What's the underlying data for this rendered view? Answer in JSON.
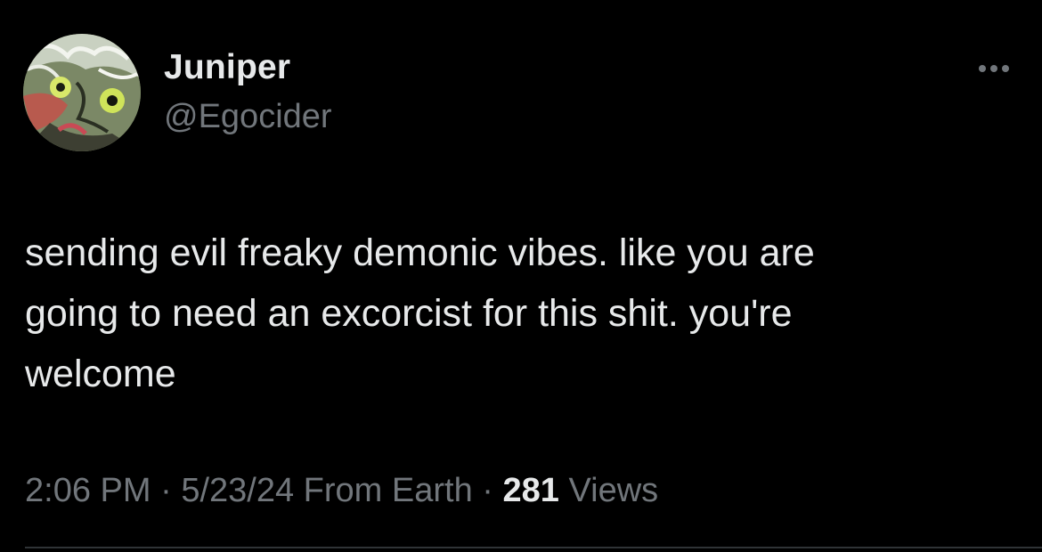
{
  "author": {
    "display_name": "Juniper",
    "handle": "@Egocider",
    "avatar_icon": "anime-character-avatar"
  },
  "more_icon": "more-horizontal-icon",
  "tweet": {
    "text": "sending evil freaky demonic vibes. like you are\ngoing to need an excorcist for this shit. you're\nwelcome"
  },
  "meta": {
    "time": "2:06 PM",
    "separator": "·",
    "date": "5/23/24",
    "source": "From Earth",
    "views_count": "281",
    "views_label": "Views"
  },
  "colors": {
    "background": "#000000",
    "primary_text": "#e7e9ea",
    "secondary_text": "#71767b",
    "divider": "#2f3336"
  }
}
